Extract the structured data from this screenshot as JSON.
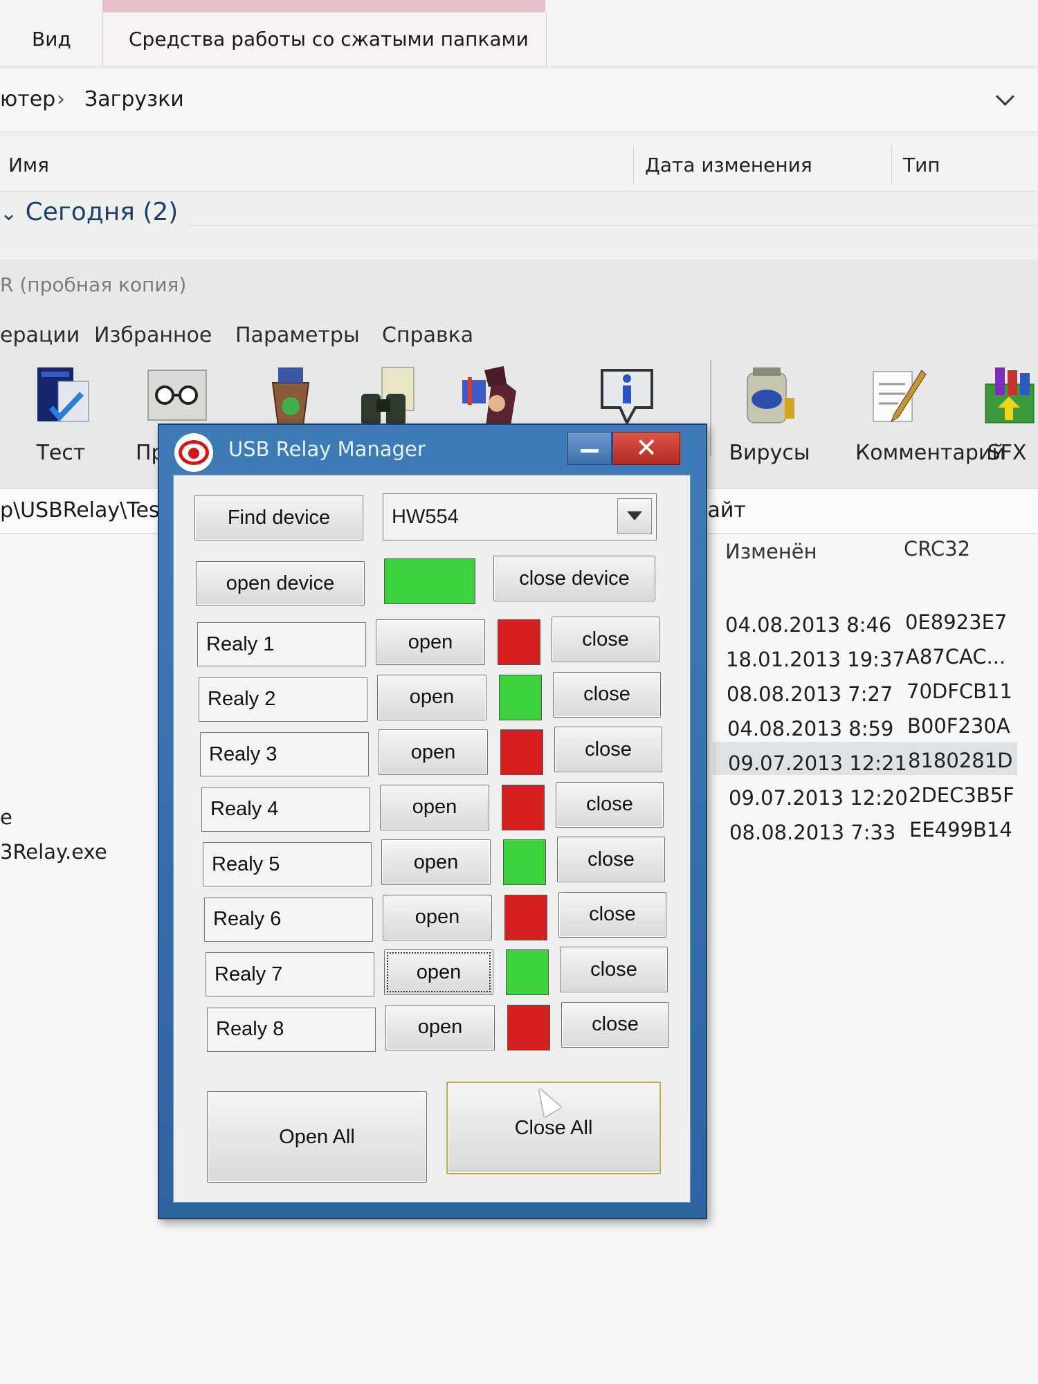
{
  "explorer": {
    "tabs": [
      "Вид",
      "Средства работы со сжатыми папками"
    ],
    "breadcrumb": {
      "left": "ютер",
      "separator": "›",
      "current": "Загрузки"
    },
    "columns": {
      "name": "Имя",
      "date": "Дата изменения",
      "type": "Тип"
    },
    "group": "Сегодня (2)"
  },
  "winrar": {
    "title": "R (пробная копия)",
    "menu": [
      "ерации",
      "Избранное",
      "Параметры",
      "Справка"
    ],
    "toolbar": [
      {
        "label": "Тест",
        "icon": "test-book-icon"
      },
      {
        "label": "Пр",
        "icon": "view-glasses-icon"
      },
      {
        "label": "",
        "icon": "delete-bin-icon"
      },
      {
        "label": "",
        "icon": "find-binoculars-icon"
      },
      {
        "label": "",
        "icon": "wizard-icon"
      },
      {
        "label": "",
        "icon": "info-icon"
      },
      {
        "label": "Вирусы",
        "icon": "virus-scan-icon"
      },
      {
        "label": "Комментарий",
        "icon": "comment-icon"
      },
      {
        "label": "SFX",
        "icon": "sfx-icon"
      }
    ],
    "path": "p\\USBRelay\\Tes",
    "path_right": "байт",
    "list_columns": {
      "modified": "Изменён",
      "crc": "CRC32"
    },
    "left_files": [
      "e",
      "3Relay.exe"
    ],
    "rows": [
      {
        "modified": "04.08.2013 8:46",
        "crc": "0E8923E7"
      },
      {
        "modified": "18.01.2013 19:37",
        "crc": "A87CAC..."
      },
      {
        "modified": "08.08.2013 7:27",
        "crc": "70DFCB11"
      },
      {
        "modified": "04.08.2013 8:59",
        "crc": "B00F230A"
      },
      {
        "modified": "09.07.2013 12:21",
        "crc": "8180281D"
      },
      {
        "modified": "09.07.2013 12:20",
        "crc": "2DEC3B5F"
      },
      {
        "modified": "08.08.2013 7:33",
        "crc": "EE499B14"
      }
    ]
  },
  "dialog": {
    "title": "USB Relay Manager",
    "find_device": "Find device",
    "device_selected": "HW554",
    "open_device": "open device",
    "close_device": "close device",
    "device_status_color": "#3fd23f",
    "open_label": "open",
    "close_label": "close",
    "relays": [
      {
        "name": "Realy 1",
        "on": false
      },
      {
        "name": "Realy 2",
        "on": true
      },
      {
        "name": "Realy 3",
        "on": false
      },
      {
        "name": "Realy 4",
        "on": false
      },
      {
        "name": "Realy 5",
        "on": true
      },
      {
        "name": "Realy 6",
        "on": false
      },
      {
        "name": "Realy 7",
        "on": true
      },
      {
        "name": "Realy 8",
        "on": false
      }
    ],
    "colors": {
      "on": "#3fd23f",
      "off": "#d62020"
    },
    "open_all": "Open All",
    "close_all": "Close All"
  }
}
